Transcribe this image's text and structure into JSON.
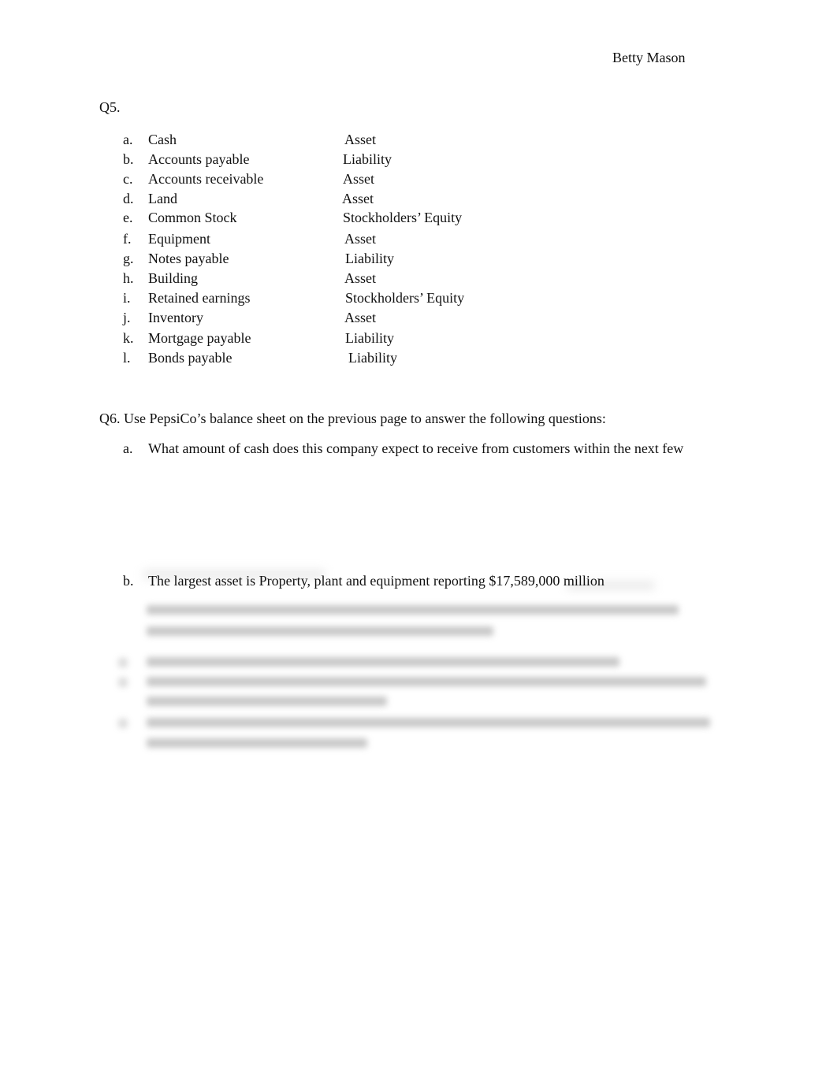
{
  "header": {
    "author": "Betty Mason"
  },
  "q5": {
    "label": "Q5.",
    "items": [
      {
        "letter": "a.",
        "name": "Cash",
        "classification": "Asset"
      },
      {
        "letter": "b.",
        "name": "Accounts payable",
        "classification": "Liability"
      },
      {
        "letter": "c.",
        "name": "Accounts receivable",
        "classification": "Asset"
      },
      {
        "letter": "d.",
        "name": "Land",
        "classification": "Asset"
      },
      {
        "letter": "e.",
        "name": "Common Stock",
        "classification": "Stockholders’ Equity"
      },
      {
        "letter": "f.",
        "name": "Equipment",
        "classification": "Asset"
      },
      {
        "letter": "g.",
        "name": "Notes payable",
        "classification": "Liability"
      },
      {
        "letter": "h.",
        "name": "Building",
        "classification": "Asset"
      },
      {
        "letter": "i.",
        "name": "Retained earnings",
        "classification": "Stockholders’ Equity"
      },
      {
        "letter": "j.",
        "name": "Inventory",
        "classification": "Asset"
      },
      {
        "letter": "k.",
        "name": "Mortgage payable",
        "classification": "Liability"
      },
      {
        "letter": "l.",
        "name": "Bonds payable",
        "classification": "Liability"
      }
    ]
  },
  "q6": {
    "prompt": "Q6. Use PepsiCo’s balance sheet on the previous page to answer the following questions:",
    "a": {
      "letter": "a.",
      "text": "What amount of cash does this company expect to receive from customers within the next few"
    },
    "b": {
      "letter": "b.",
      "text": "The largest asset is Property, plant and equipment reporting $17,589,000 million"
    }
  }
}
